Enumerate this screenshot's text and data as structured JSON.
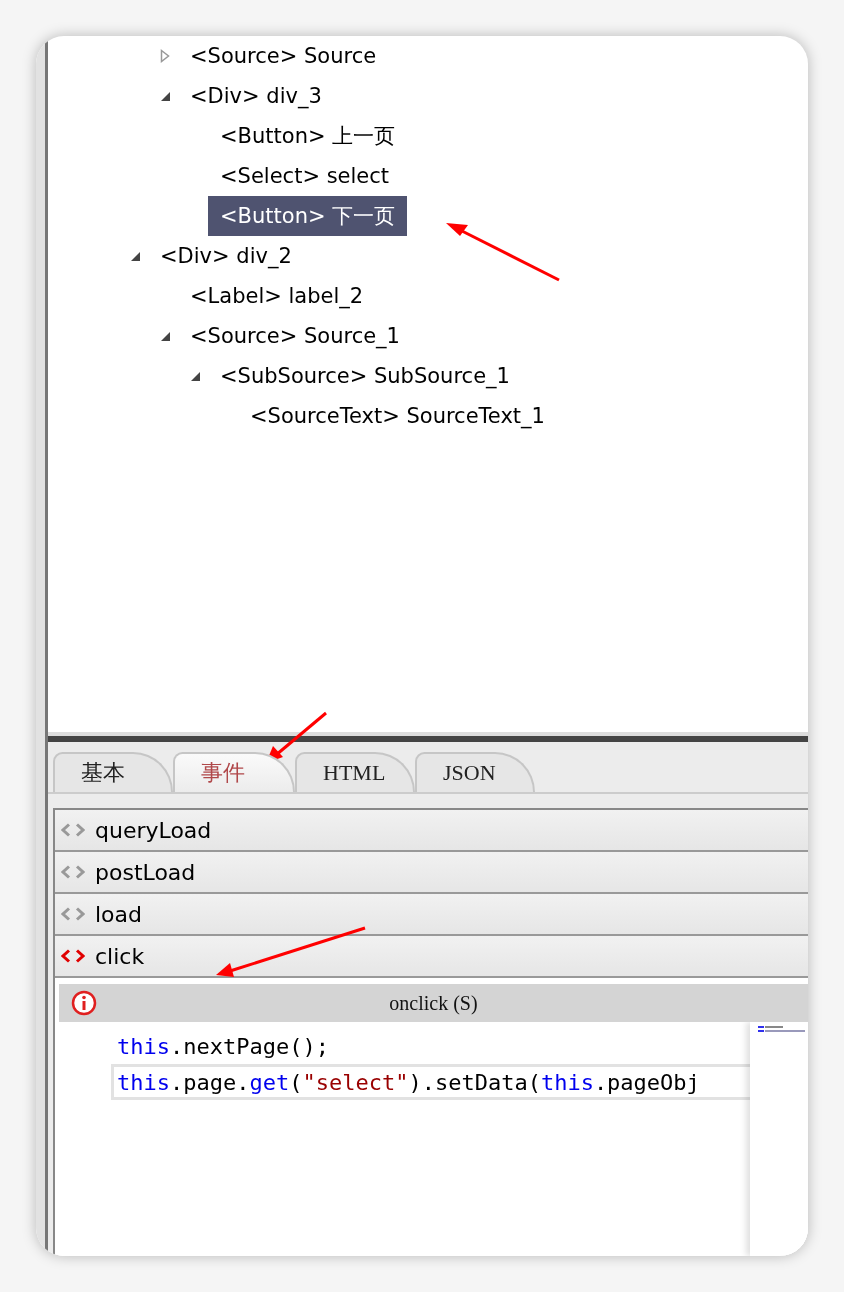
{
  "tree": {
    "nodes": [
      {
        "children": [
          {
            "label": "<Source> Source",
            "expanded": false,
            "selected": false
          },
          {
            "label": "<Div> div_3",
            "expanded": true,
            "selected": false,
            "children": [
              {
                "label": "<Button> 上一页",
                "selected": false
              },
              {
                "label": "<Select> select",
                "selected": false
              },
              {
                "label": "<Button> 下一页",
                "selected": true
              }
            ]
          }
        ]
      },
      {
        "label": "<Div> div_2",
        "expanded": true,
        "selected": false,
        "children": [
          {
            "label": "<Label> label_2",
            "selected": false
          },
          {
            "label": "<Source> Source_1",
            "expanded": true,
            "selected": false,
            "children": [
              {
                "label": "<SubSource> SubSource_1",
                "expanded": true,
                "selected": false,
                "children": [
                  {
                    "label": "<SourceText> SourceText_1",
                    "selected": false
                  }
                ]
              }
            ]
          }
        ]
      }
    ]
  },
  "tabs": [
    {
      "label": "基本",
      "selected": false
    },
    {
      "label": "事件",
      "selected": true
    },
    {
      "label": "HTML",
      "selected": false
    },
    {
      "label": "JSON",
      "selected": false
    }
  ],
  "events": [
    {
      "name": "queryLoad",
      "expanded": false
    },
    {
      "name": "postLoad",
      "expanded": false
    },
    {
      "name": "load",
      "expanded": false
    },
    {
      "name": "click",
      "expanded": true
    }
  ],
  "editor": {
    "title": "onclick (S)",
    "lines": [
      {
        "current": false,
        "tokens": [
          {
            "kind": "keyword",
            "text": "this"
          },
          {
            "kind": "plain",
            "text": ".nextPage();"
          }
        ]
      },
      {
        "current": true,
        "tokens": [
          {
            "kind": "keyword",
            "text": "this"
          },
          {
            "kind": "plain",
            "text": ".page."
          },
          {
            "kind": "keyword",
            "text": "get"
          },
          {
            "kind": "plain",
            "text": "("
          },
          {
            "kind": "string",
            "text": "\"select\""
          },
          {
            "kind": "plain",
            "text": ").setData("
          },
          {
            "kind": "keyword",
            "text": "this"
          },
          {
            "kind": "plain",
            "text": ".pageObj"
          }
        ]
      }
    ]
  }
}
